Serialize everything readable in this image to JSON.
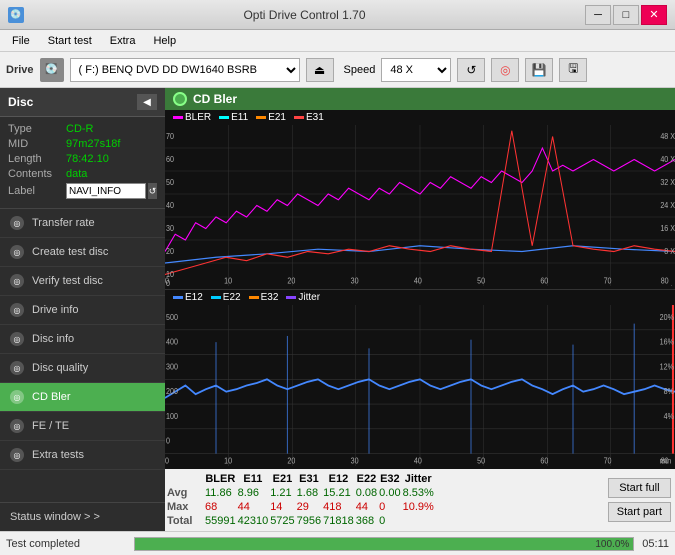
{
  "titleBar": {
    "icon": "💿",
    "title": "Opti Drive Control 1.70",
    "minimize": "─",
    "maximize": "□",
    "close": "✕"
  },
  "menuBar": {
    "items": [
      "File",
      "Start test",
      "Extra",
      "Help"
    ]
  },
  "driveBar": {
    "label": "Drive",
    "driveValue": "(F:)  BENQ DVD DD DW1640 BSRB",
    "speedLabel": "Speed",
    "speedValue": "48 X"
  },
  "sidebar": {
    "disc": {
      "title": "Disc",
      "type_label": "Type",
      "type_val": "CD-R",
      "mid_label": "MID",
      "mid_val": "97m27s18f",
      "length_label": "Length",
      "length_val": "78:42.10",
      "contents_label": "Contents",
      "contents_val": "data",
      "label_label": "Label",
      "label_val": "NAVI_INFO"
    },
    "items": [
      {
        "id": "transfer-rate",
        "label": "Transfer rate",
        "active": false
      },
      {
        "id": "create-test-disc",
        "label": "Create test disc",
        "active": false
      },
      {
        "id": "verify-test-disc",
        "label": "Verify test disc",
        "active": false
      },
      {
        "id": "drive-info",
        "label": "Drive info",
        "active": false
      },
      {
        "id": "disc-info",
        "label": "Disc info",
        "active": false
      },
      {
        "id": "disc-quality",
        "label": "Disc quality",
        "active": false
      },
      {
        "id": "cd-bler",
        "label": "CD Bler",
        "active": true
      },
      {
        "id": "fe-te",
        "label": "FE / TE",
        "active": false
      },
      {
        "id": "extra-tests",
        "label": "Extra tests",
        "active": false
      }
    ],
    "statusWindow": "Status window > >"
  },
  "chart1": {
    "title": "CD Bler",
    "legend": [
      {
        "label": "BLER",
        "color": "#ff00ff"
      },
      {
        "label": "E11",
        "color": "#00ffff"
      },
      {
        "label": "E21",
        "color": "#ff6600"
      },
      {
        "label": "E31",
        "color": "#ff0000"
      }
    ],
    "yAxisLabel": "48 X",
    "yMax": 70,
    "xMax": 80
  },
  "chart2": {
    "legend": [
      {
        "label": "E12",
        "color": "#0066ff"
      },
      {
        "label": "E22",
        "color": "#00ccff"
      },
      {
        "label": "E32",
        "color": "#ff6600"
      },
      {
        "label": "Jitter",
        "color": "#8844ff"
      }
    ],
    "yAxisLabel": "20%",
    "yMax": 500,
    "xMax": 80
  },
  "dataTable": {
    "headers": [
      "",
      "BLER",
      "E11",
      "E21",
      "E31",
      "E12",
      "E22",
      "E32",
      "Jitter"
    ],
    "rows": [
      {
        "label": "Avg",
        "values": [
          "11.86",
          "8.96",
          "1.21",
          "1.68",
          "15.21",
          "0.08",
          "0.00",
          "8.53%"
        ],
        "color": "green"
      },
      {
        "label": "Max",
        "values": [
          "68",
          "44",
          "14",
          "29",
          "418",
          "44",
          "0",
          "10.9%"
        ],
        "color": "red"
      },
      {
        "label": "Total",
        "values": [
          "55991",
          "42310",
          "5725",
          "7956",
          "71818",
          "368",
          "0",
          ""
        ],
        "color": "green"
      }
    ]
  },
  "buttons": {
    "startFull": "Start full",
    "startPart": "Start part"
  },
  "statusBar": {
    "status": "Test completed",
    "progress": 100,
    "progressText": "100.0%",
    "time": "05:11"
  }
}
